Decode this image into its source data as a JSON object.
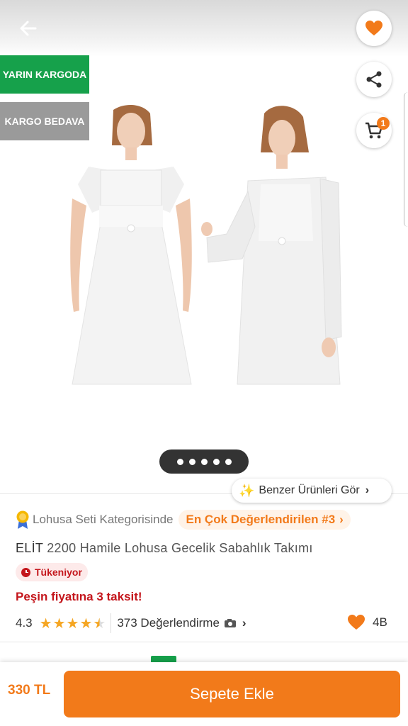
{
  "colors": {
    "accent": "#f27a1a",
    "green": "#16a14b",
    "red": "#c4161c",
    "star": "#f5a623"
  },
  "header": {
    "back_icon": "arrow-left-icon",
    "favorite_icon": "heart-icon",
    "share_icon": "share-icon",
    "cart_icon": "cart-icon",
    "cart_count": "1"
  },
  "badges": {
    "next_day": "YARIN KARGODA",
    "free_shipping": "KARGO BEDAVA"
  },
  "gallery": {
    "page_count": 5,
    "current_page": 1
  },
  "similar": {
    "label": "Benzer Ürünleri Gör"
  },
  "category": {
    "text": "Lohusa Seti Kategorisinde",
    "rank": "En Çok Değerlendirilen #3"
  },
  "product": {
    "brand": "ELİT",
    "name": "2200 Hamile Lohusa Gecelik Sabahlık Takımı",
    "stock_status": "Tükeniyor",
    "installment": "Peşin fiyatına 3 taksit!"
  },
  "rating": {
    "score": "4.3",
    "stars": 4.3,
    "reviews": "373 Değerlendirme"
  },
  "favorites": {
    "count": "4B"
  },
  "footer": {
    "price": "330 TL",
    "add_to_cart": "Sepete Ekle"
  }
}
